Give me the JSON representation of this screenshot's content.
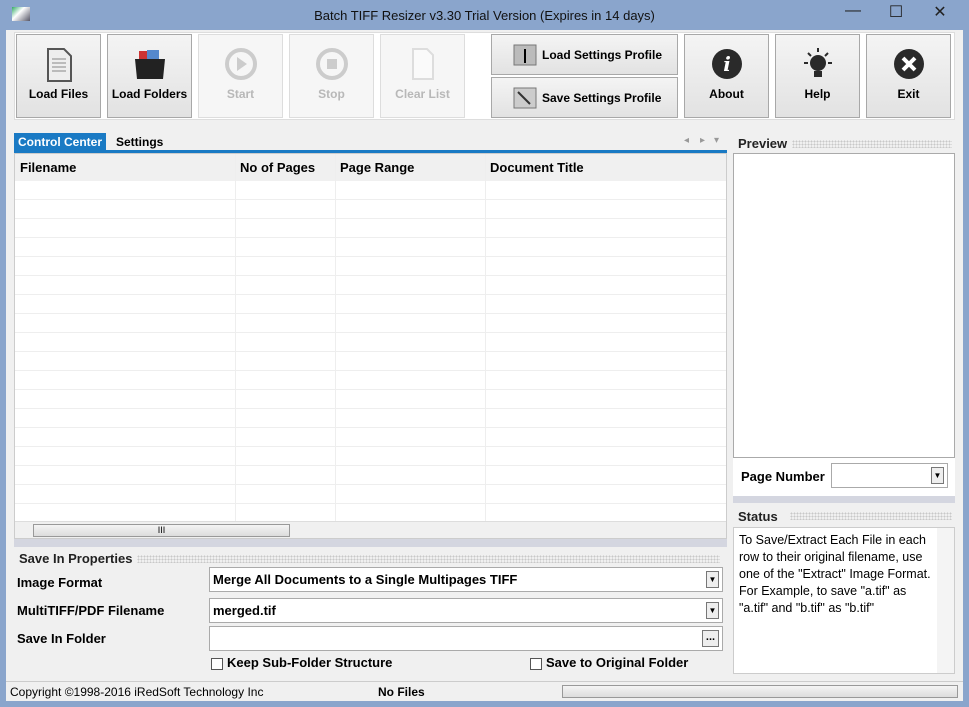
{
  "window": {
    "title": "Batch TIFF Resizer v3.30   Trial Version (Expires in 14 days)",
    "minimize": "—",
    "maximize": "☐",
    "close": "✕"
  },
  "toolbar": {
    "load_files": "Load Files",
    "load_folders": "Load Folders",
    "start": "Start",
    "stop": "Stop",
    "clear_list": "Clear List",
    "load_profile": "Load Settings Profile",
    "save_profile": "Save Settings Profile",
    "about": "About",
    "help": "Help",
    "exit": "Exit"
  },
  "tabs": [
    {
      "label": "Control Center",
      "active": true
    },
    {
      "label": "Settings",
      "active": false
    }
  ],
  "tab_nav": {
    "prev": "◂",
    "next": "▸",
    "menu": "▾"
  },
  "grid": {
    "columns": [
      "Filename",
      "No of Pages",
      "Page Range",
      "Document Title"
    ],
    "rows": [],
    "scroll_grip": "III"
  },
  "save_props": {
    "title": "Save In Properties",
    "image_format_label": "Image Format",
    "image_format_value": "Merge All Documents to a Single Multipages TIFF",
    "filename_label": "MultiTIFF/PDF Filename",
    "filename_value": "merged.tif",
    "folder_label": "Save In Folder",
    "folder_value": "",
    "browse": "...",
    "keep_sub": "Keep Sub-Folder Structure",
    "keep_sub_checked": false,
    "save_orig": "Save to Original Folder",
    "save_orig_checked": false
  },
  "preview": {
    "title": "Preview",
    "page_number_label": "Page Number",
    "page_number_value": ""
  },
  "status": {
    "title": "Status",
    "text": "To Save/Extract Each File in each row to their original filename, use one of the \"Extract\" Image Format. For Example, to save \"a.tif\" as \"a.tif\" and \"b.tif\" as \"b.tif\""
  },
  "statusbar": {
    "copyright": "Copyright ©1998-2016 iRedSoft Technology Inc",
    "files": "No Files",
    "progress": 0
  }
}
